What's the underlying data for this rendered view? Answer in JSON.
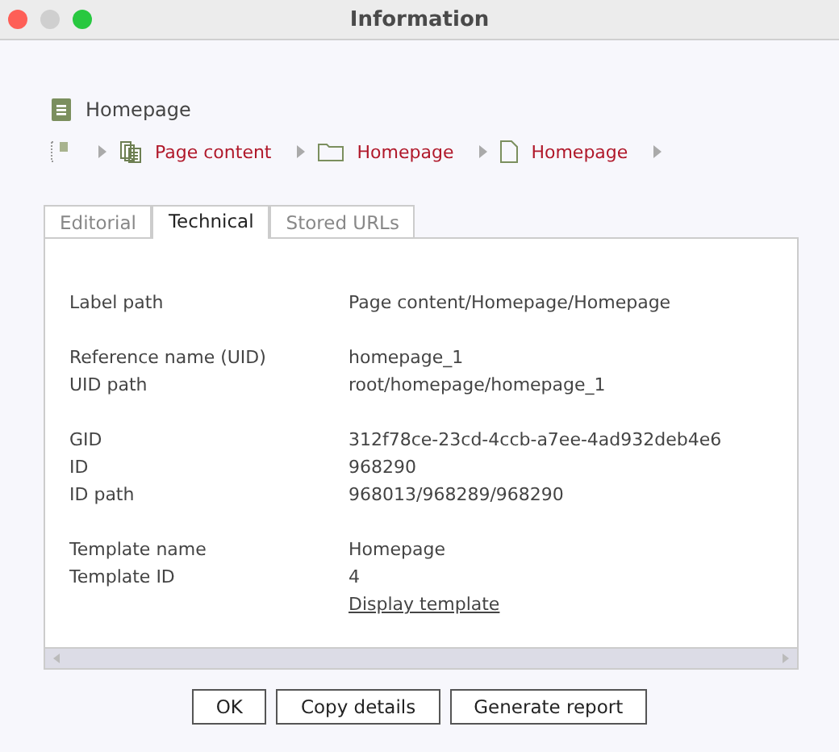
{
  "window": {
    "title": "Information"
  },
  "page": {
    "title": "Homepage"
  },
  "breadcrumb": [
    {
      "kind": "pages",
      "label": "Page content"
    },
    {
      "kind": "folder",
      "label": "Homepage"
    },
    {
      "kind": "page",
      "label": "Homepage"
    }
  ],
  "tabs": [
    {
      "label": "Editorial",
      "selected": false
    },
    {
      "label": "Technical",
      "selected": true
    },
    {
      "label": "Stored URLs",
      "selected": false
    }
  ],
  "details": [
    [
      {
        "label": "Label path",
        "value": "Page content/Homepage/Homepage"
      }
    ],
    [
      {
        "label": "Reference name (UID)",
        "value": "homepage_1"
      },
      {
        "label": "UID path",
        "value": "root/homepage/homepage_1"
      }
    ],
    [
      {
        "label": "GID",
        "value": "312f78ce-23cd-4ccb-a7ee-4ad932deb4e6"
      },
      {
        "label": "ID",
        "value": "968290"
      },
      {
        "label": "ID path",
        "value": "968013/968289/968290"
      }
    ],
    [
      {
        "label": "Template name",
        "value": "Homepage"
      },
      {
        "label": "Template ID",
        "value": "4"
      },
      {
        "kind": "link",
        "value": "Display template "
      }
    ]
  ],
  "buttons": [
    "OK",
    "Copy details",
    "Generate report"
  ]
}
